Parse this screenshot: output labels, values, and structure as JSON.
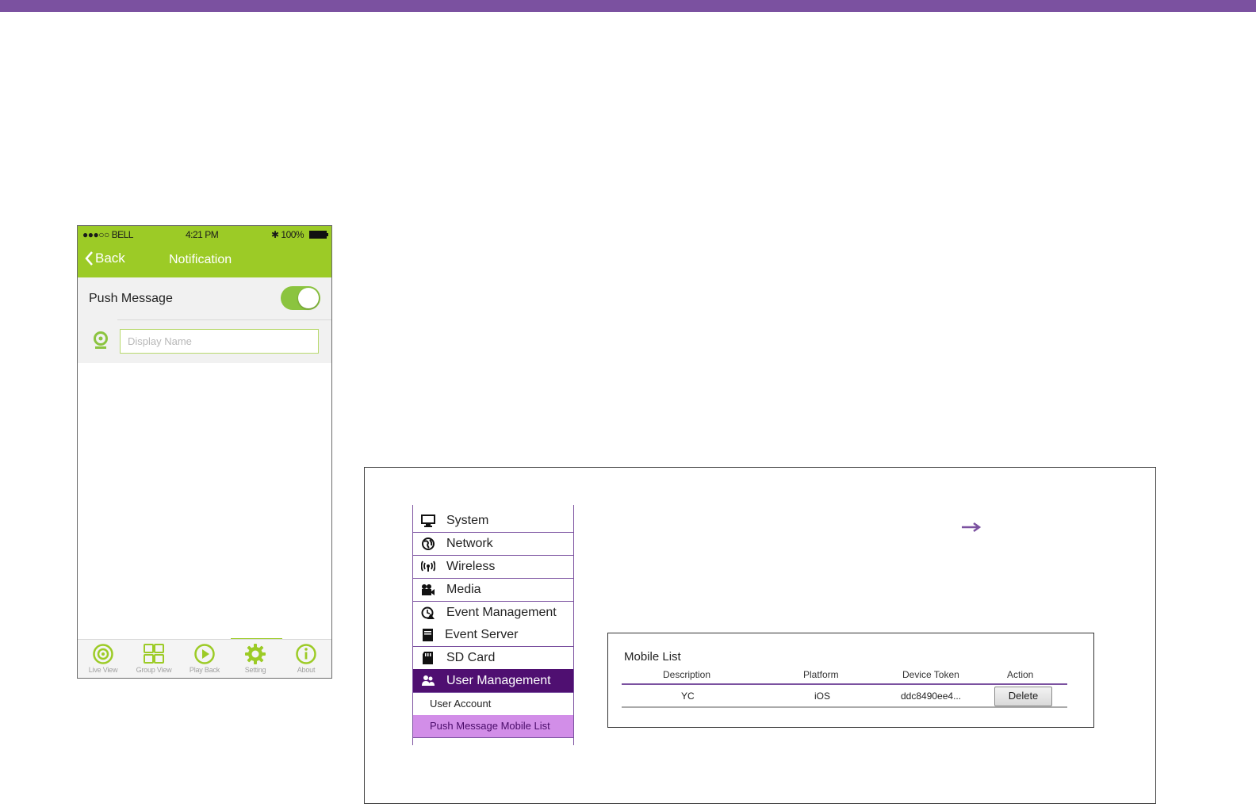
{
  "colors": {
    "brand_purple": "#7b51a0",
    "app_green": "#9ccb26",
    "menu_active": "#4f0f71",
    "submenu_active": "#d28ee8"
  },
  "phone": {
    "status": {
      "carrier": "●●●○○ BELL",
      "time": "4:21 PM",
      "battery": "100%"
    },
    "nav": {
      "back_label": "Back",
      "title": "Notification"
    },
    "push_message": {
      "label": "Push Message",
      "enabled": true
    },
    "display_name": {
      "placeholder": "Display Name",
      "icon": "webcam-icon"
    },
    "tabs": [
      {
        "label": "Live View",
        "icon": "live-view-icon"
      },
      {
        "label": "Group View",
        "icon": "group-view-icon"
      },
      {
        "label": "Play Back",
        "icon": "play-back-icon"
      },
      {
        "label": "Setting",
        "icon": "gear-icon",
        "active": true
      },
      {
        "label": "About",
        "icon": "info-icon"
      }
    ]
  },
  "web": {
    "menu": [
      {
        "label": "System",
        "icon": "monitor-icon"
      },
      {
        "label": "Network",
        "icon": "globe-icon"
      },
      {
        "label": "Wireless",
        "icon": "wireless-icon"
      },
      {
        "label": "Media",
        "icon": "camera-icon"
      },
      {
        "label": "Event Management",
        "icon": "event-management-icon"
      },
      {
        "label": "Event Server",
        "icon": "server-icon"
      },
      {
        "label": "SD Card",
        "icon": "sd-card-icon"
      },
      {
        "label": "User Management",
        "icon": "users-icon",
        "active": true
      }
    ],
    "submenu": [
      {
        "label": "User Account"
      },
      {
        "label": "Push Message Mobile List",
        "active": true
      }
    ],
    "arrow": "→",
    "mobile_list": {
      "title": "Mobile List",
      "columns": [
        "Description",
        "Platform",
        "Device Token",
        "Action"
      ],
      "rows": [
        {
          "description": "YC",
          "platform": "iOS",
          "device_token": "ddc8490ee4...",
          "action": "Delete"
        }
      ]
    }
  }
}
